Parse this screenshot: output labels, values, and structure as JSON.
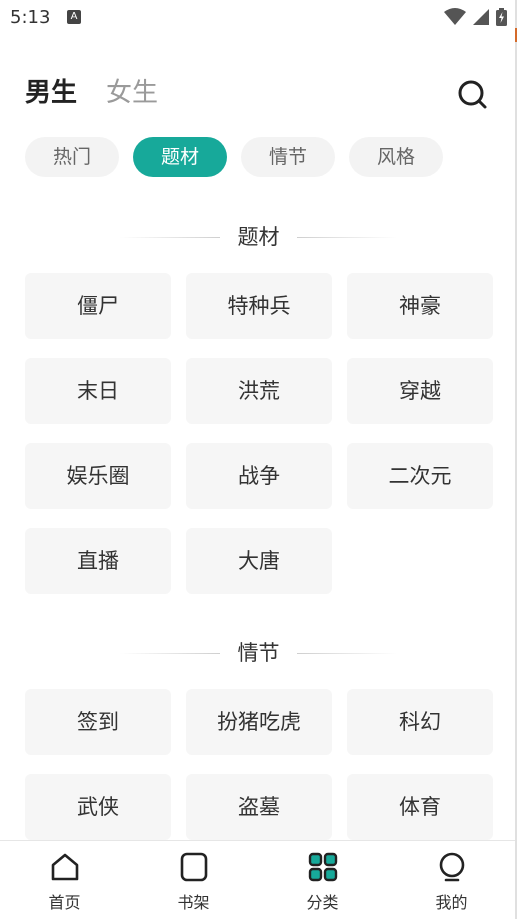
{
  "status_bar": {
    "time": "5:13",
    "notification_icon": "A"
  },
  "header": {
    "tab_male": "男生",
    "tab_female": "女生"
  },
  "chips": [
    "热门",
    "题材",
    "情节",
    "风格"
  ],
  "active_chip": "题材",
  "sections": [
    {
      "title": "题材",
      "items": [
        "僵尸",
        "特种兵",
        "神豪",
        "末日",
        "洪荒",
        "穿越",
        "娱乐圈",
        "战争",
        "二次元",
        "直播",
        "大唐"
      ]
    },
    {
      "title": "情节",
      "items": [
        "签到",
        "扮猪吃虎",
        "科幻",
        "武侠",
        "盗墓",
        "体育"
      ]
    }
  ],
  "bottom_nav": [
    {
      "label": "首页",
      "icon": "home-icon"
    },
    {
      "label": "书架",
      "icon": "bookshelf-icon"
    },
    {
      "label": "分类",
      "icon": "category-icon"
    },
    {
      "label": "我的",
      "icon": "profile-icon"
    }
  ],
  "colors": {
    "accent": "#17a99a",
    "chip_bg": "#f3f3f3",
    "cell_bg": "#f6f6f6"
  }
}
